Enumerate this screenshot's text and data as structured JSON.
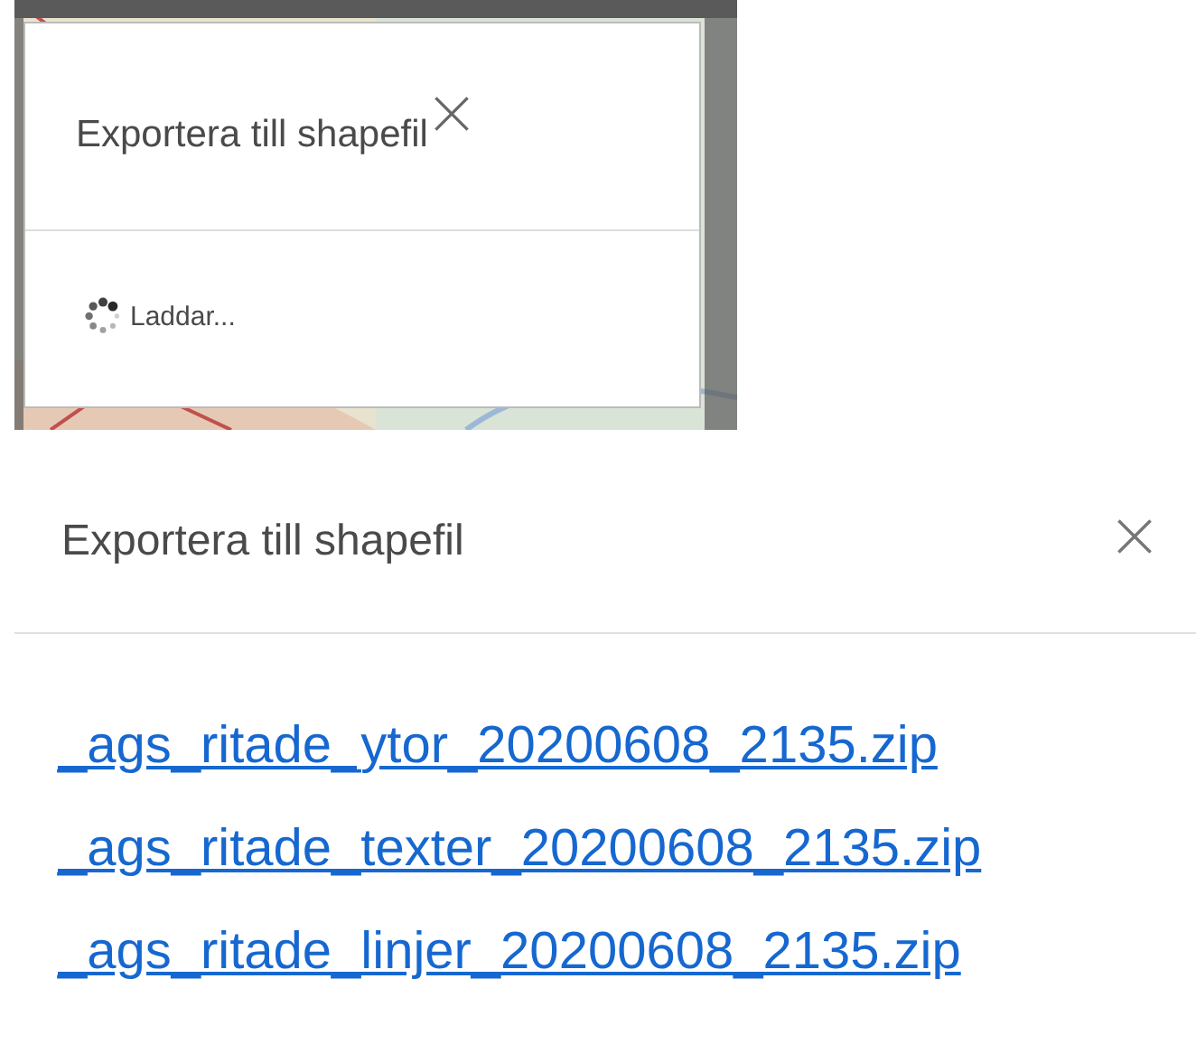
{
  "loading_dialog": {
    "title": "Exportera till shapefil",
    "status": "Laddar..."
  },
  "result_dialog": {
    "title": "Exportera till shapefil",
    "files": [
      "_ags_ritade_ytor_20200608_2135.zip",
      "_ags_ritade_texter_20200608_2135.zip",
      "_ags_ritade_linjer_20200608_2135.zip"
    ]
  }
}
